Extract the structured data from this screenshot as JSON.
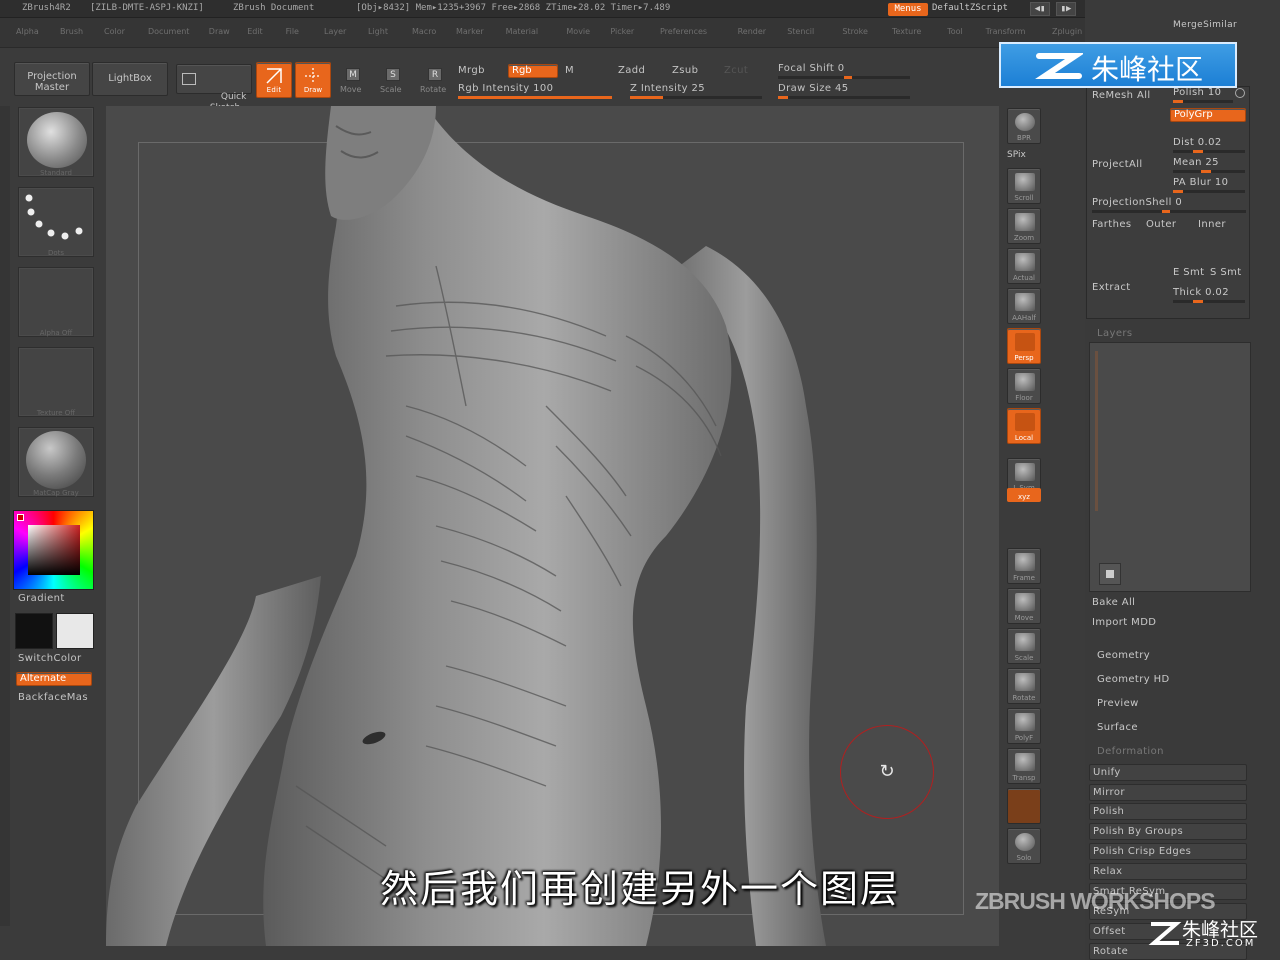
{
  "titlebar": {
    "app": "ZBrush4R2",
    "serial": "[ZILB-DMTE-ASPJ-KNZI]",
    "document": "ZBrush Document",
    "status": "[Obj▸8432] Mem▸1235+3967 Free▸2868 ZTime▸28.02 Timer▸7.489",
    "menus_label": "Menus",
    "script_label": "DefaultZScript",
    "mergesimilar": "MergeSimilar"
  },
  "menubar": {
    "items": [
      "Alpha",
      "Brush",
      "Color",
      "Document",
      "Draw",
      "Edit",
      "File",
      "Layer",
      "Light",
      "Macro",
      "Marker",
      "Material",
      "Movie",
      "Picker",
      "Preferences",
      "Render",
      "Stencil",
      "Stroke",
      "Texture",
      "Tool",
      "Transform",
      "Zplugin",
      "Zscript"
    ]
  },
  "shelf": {
    "projection_master": "Projection\nMaster",
    "lightbox": "LightBox",
    "quick_sketch": "Quick\nSketch",
    "edit": "Edit",
    "draw": "Draw",
    "move": "Move",
    "scale": "Scale",
    "rotate": "Rotate",
    "mrgb": "Mrgb",
    "rgb": "Rgb",
    "m": "M",
    "rgb_intensity": "Rgb Intensity 100",
    "rgb_intensity_value": 1.0,
    "zadd": "Zadd",
    "zsub": "Zsub",
    "zcut": "Zcut",
    "z_intensity": "Z Intensity 25",
    "z_intensity_value": 0.25,
    "focal_shift": "Focal Shift 0",
    "draw_size": "Draw Size 45"
  },
  "left": {
    "gradient": "Gradient",
    "switch_color": "SwitchColor",
    "alternate": "Alternate",
    "backface": "BackfaceMas"
  },
  "tools": [
    {
      "name": "bpr",
      "label": "BPR"
    },
    {
      "name": "spix",
      "label": "SPix"
    },
    {
      "name": "scroll",
      "label": "Scroll"
    },
    {
      "name": "zoom",
      "label": "Zoom"
    },
    {
      "name": "actual",
      "label": "Actual"
    },
    {
      "name": "aahalf",
      "label": "AAHalf"
    },
    {
      "name": "persp",
      "label": "Persp"
    },
    {
      "name": "floor",
      "label": "Floor"
    },
    {
      "name": "local",
      "label": "Local"
    },
    {
      "name": "lsym",
      "label": "L.Sym"
    },
    {
      "name": "xyz",
      "label": "xyz"
    },
    {
      "name": "frame",
      "label": "Frame"
    },
    {
      "name": "move",
      "label": "Move"
    },
    {
      "name": "scale",
      "label": "Scale"
    },
    {
      "name": "rotate",
      "label": "Rotate"
    },
    {
      "name": "polyf",
      "label": "PolyF"
    },
    {
      "name": "transp",
      "label": "Transp"
    },
    {
      "name": "solo",
      "label": "Solo"
    }
  ],
  "right": {
    "remesh_all": "ReMesh All",
    "polish": "Polish 10",
    "polygrp": "PolyGrp",
    "project_all": "ProjectAll",
    "dist": "Dist 0.02",
    "mean": "Mean 25",
    "pa_blur": "PA Blur 10",
    "projection_shell": "ProjectionShell 0",
    "farthest": "Farthes",
    "outer": "Outer",
    "inner": "Inner",
    "extract": "Extract",
    "e_smt": "E Smt",
    "s_smt": "S Smt",
    "thick": "Thick 0.02",
    "layers": "Layers",
    "bake_all": "Bake All",
    "import_mdd": "Import MDD",
    "geometry": "Geometry",
    "geometry_hd": "Geometry HD",
    "preview": "Preview",
    "surface": "Surface",
    "deformation": "Deformation",
    "unify": "Unify",
    "mirror": "Mirror",
    "polish2": "Polish",
    "polish_by_groups": "Polish By Groups",
    "polish_crisp_edges": "Polish Crisp Edges",
    "relax": "Relax",
    "smart_resym": "Smart ReSym",
    "resym": "ReSym",
    "offset": "Offset",
    "rotate": "Rotate"
  },
  "watermark": {
    "logo_top": "朱峰社区",
    "workshops": "ZBRUSH WORKSHOPS",
    "logo_bottom": "朱峰社区",
    "logo_bottom_url": "ZF3D.COM"
  },
  "subtitle": "然后我们再创建另外一个图层",
  "colors": {
    "accent": "#e8661c",
    "bg": "#3b3b3b",
    "canvas": "#4a4a4a",
    "logo_blue": "#2a8ee0"
  }
}
